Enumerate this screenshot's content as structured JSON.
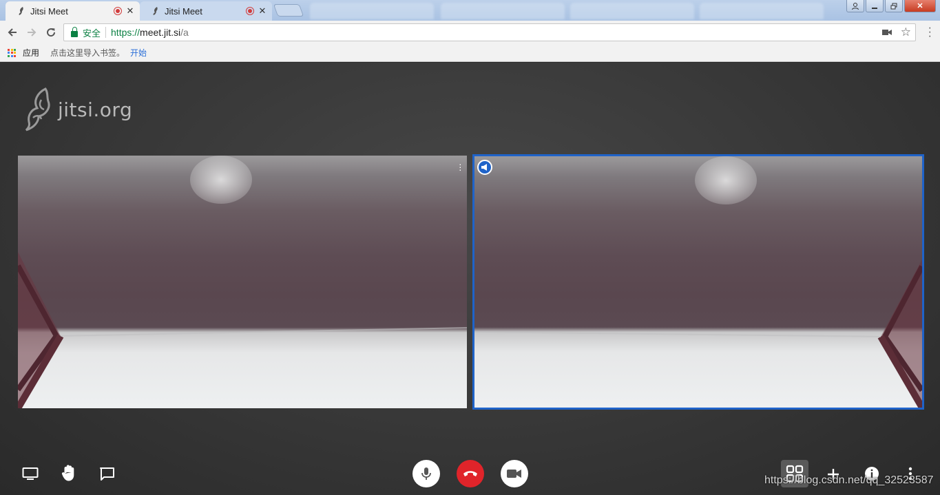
{
  "browser": {
    "tabs": [
      {
        "title": "Jitsi Meet",
        "active": true
      },
      {
        "title": "Jitsi Meet",
        "active": false
      }
    ],
    "address": {
      "secure_label": "安全",
      "url_scheme": "https://",
      "url_host": "meet.jit.si",
      "url_path": "/a"
    },
    "bookmarks": {
      "apps_label": "应用",
      "import_hint": "点击这里导入书签。",
      "start_link": "开始"
    }
  },
  "meeting": {
    "logo_text": "jitsi.org",
    "tiles": [
      {
        "role": "local-participant",
        "highlighted": false
      },
      {
        "role": "dominant-speaker",
        "highlighted": true
      }
    ],
    "highlight_color": "#1f63c9",
    "hangup_color": "#e0242a"
  },
  "watermark": "https://blog.csdn.net/qq_32523587"
}
